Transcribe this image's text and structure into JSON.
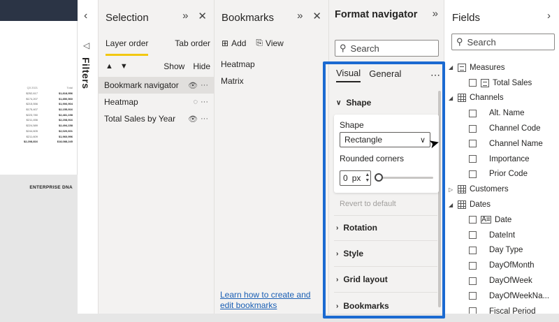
{
  "canvas": {
    "table": {
      "header": [
        "Q3 2021",
        "Total"
      ],
      "rows": [
        [
          "$252,617",
          "$1,818,956"
        ],
        [
          "$174,207",
          "$1,850,560"
        ],
        [
          "$215,556",
          "$1,906,904"
        ],
        [
          "$175,407",
          "$2,155,916"
        ],
        [
          "$223,780",
          "$2,481,198"
        ],
        [
          "$211,456",
          "$2,208,916"
        ],
        [
          "$224,589",
          "$2,494,158"
        ],
        [
          "$244,605",
          "$2,020,601"
        ],
        [
          "$211,609",
          "$1,960,996"
        ],
        [
          "$2,208,816",
          "$18,088,245"
        ]
      ]
    },
    "brand": "ENTERPRISE DNA"
  },
  "filters": {
    "label": "Filters",
    "collapse_glyph": "‹",
    "funnel_glyph": "◁"
  },
  "selection": {
    "title": "Selection",
    "tabs": [
      "Layer order",
      "Tab order"
    ],
    "up_glyph": "▲",
    "down_glyph": "▼",
    "show": "Show",
    "hide": "Hide",
    "items": [
      {
        "name": "Bookmark navigator",
        "visible": true
      },
      {
        "name": "Heatmap",
        "visible": false
      },
      {
        "name": "Total Sales by Year",
        "visible": true
      }
    ],
    "eye_glyph": "👁",
    "eye_off_glyph": "◌",
    "more_glyph": "···"
  },
  "bookmarks": {
    "title": "Bookmarks",
    "add_label": "Add",
    "view_label": "View",
    "items": [
      "Heatmap",
      "Matrix"
    ],
    "help_link": "Learn how to create and edit bookmarks"
  },
  "format": {
    "title": "Format navigator",
    "search_placeholder": "Search",
    "tabs": [
      "Visual",
      "General"
    ],
    "more_glyph": "⋯",
    "sections": {
      "shape": "Shape",
      "rotation": "Rotation",
      "style": "Style",
      "grid_layout": "Grid layout",
      "bookmarks": "Bookmarks"
    },
    "shape_label": "Shape",
    "shape_value": "Rectangle",
    "rounded_label": "Rounded corners",
    "rounded_value": "0",
    "rounded_unit": "px",
    "rounded_slider": 0,
    "revert": "Revert to default"
  },
  "fields": {
    "title": "Fields",
    "search_placeholder": "Search",
    "tree": [
      {
        "type": "table",
        "label": "Measures",
        "expanded": true,
        "kind": "calc"
      },
      {
        "type": "field",
        "label": "Total Sales",
        "measure": true
      },
      {
        "type": "table",
        "label": "Channels",
        "expanded": true,
        "kind": "table"
      },
      {
        "type": "field",
        "label": "Alt. Name"
      },
      {
        "type": "field",
        "label": "Channel Code"
      },
      {
        "type": "field",
        "label": "Channel Name"
      },
      {
        "type": "field",
        "label": "Importance"
      },
      {
        "type": "field",
        "label": "Prior Code"
      },
      {
        "type": "table",
        "label": "Customers",
        "expanded": false,
        "kind": "table"
      },
      {
        "type": "table",
        "label": "Dates",
        "expanded": true,
        "kind": "table"
      },
      {
        "type": "field",
        "label": "Date",
        "date": true
      },
      {
        "type": "field",
        "label": "DateInt"
      },
      {
        "type": "field",
        "label": "Day Type"
      },
      {
        "type": "field",
        "label": "DayOfMonth"
      },
      {
        "type": "field",
        "label": "DayOfWeek"
      },
      {
        "type": "field",
        "label": "DayOfWeekNa..."
      },
      {
        "type": "field",
        "label": "Fiscal Period"
      }
    ]
  },
  "icons": {
    "collapse": "»",
    "close": "✕",
    "expand_right": "›",
    "search": "⚲",
    "caret_down": "∨",
    "caret_right": "›",
    "tree_expanded": "◢",
    "tree_collapsed": "▷",
    "add": "⊞",
    "view": "⎘"
  },
  "colors": {
    "accent_tab": "#f2c811",
    "highlight_box": "#1b6ad1",
    "link": "#1a5fb4"
  }
}
